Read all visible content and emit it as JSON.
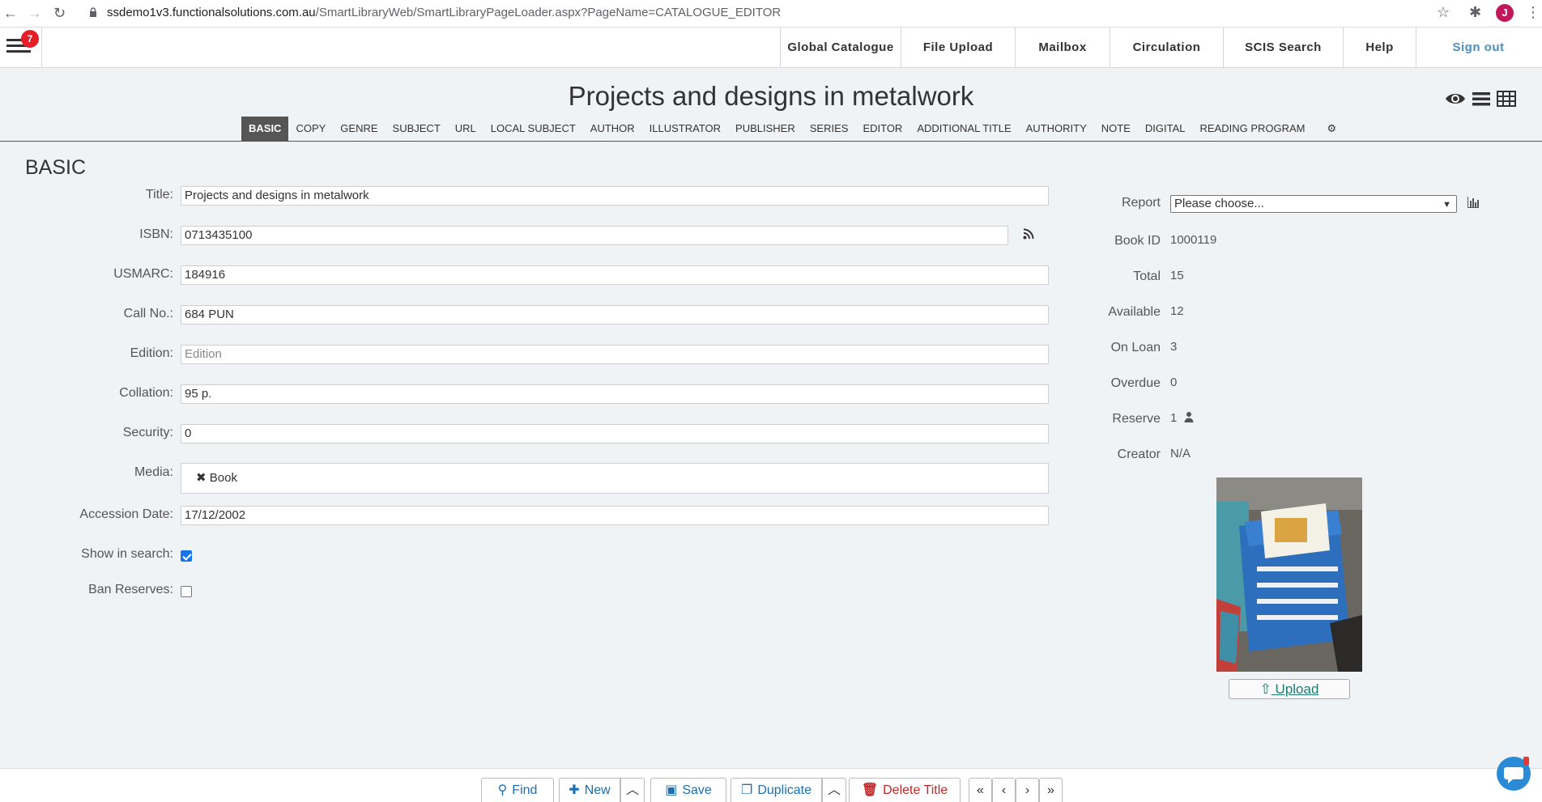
{
  "browser": {
    "url_host": "ssdemo1v3.functionalsolutions.com.au",
    "url_path": "/SmartLibraryWeb/SmartLibraryPageLoader.aspx?PageName=CATALOGUE_EDITOR",
    "profile_initial": "J"
  },
  "header": {
    "notification_count": "7",
    "menu": [
      {
        "label": "Global Catalogue"
      },
      {
        "label": "File Upload"
      },
      {
        "label": "Mailbox"
      },
      {
        "label": "Circulation"
      },
      {
        "label": "SCIS Search"
      },
      {
        "label": "Help"
      },
      {
        "label": "Sign out"
      }
    ]
  },
  "page_title": "Projects and designs in metalwork",
  "tabs": [
    {
      "label": "BASIC"
    },
    {
      "label": "COPY"
    },
    {
      "label": "GENRE"
    },
    {
      "label": "SUBJECT"
    },
    {
      "label": "URL"
    },
    {
      "label": "LOCAL SUBJECT"
    },
    {
      "label": "AUTHOR"
    },
    {
      "label": "ILLUSTRATOR"
    },
    {
      "label": "PUBLISHER"
    },
    {
      "label": "SERIES"
    },
    {
      "label": "EDITOR"
    },
    {
      "label": "ADDITIONAL TITLE"
    },
    {
      "label": "AUTHORITY"
    },
    {
      "label": "NOTE"
    },
    {
      "label": "DIGITAL"
    },
    {
      "label": "READING PROGRAM"
    },
    {
      "label": "⚙"
    }
  ],
  "section_title": "BASIC",
  "form": {
    "title": {
      "label": "Title:",
      "value": "Projects and designs in metalwork"
    },
    "isbn": {
      "label": "ISBN:",
      "value": "0713435100"
    },
    "usmarc": {
      "label": "USMARC:",
      "value": "184916"
    },
    "callno": {
      "label": "Call No.:",
      "value": "684 PUN"
    },
    "edition": {
      "label": "Edition:",
      "value": "",
      "placeholder": "Edition"
    },
    "collation": {
      "label": "Collation:",
      "value": "95 p."
    },
    "security": {
      "label": "Security:",
      "value": "0"
    },
    "media": {
      "label": "Media:",
      "tag": "Book"
    },
    "accession_date": {
      "label": "Accession Date:",
      "value": "17/12/2002"
    },
    "show_in_search": {
      "label": "Show in search:",
      "checked": true
    },
    "ban_reserves": {
      "label": "Ban Reserves:",
      "checked": false
    }
  },
  "info": {
    "report_label": "Report",
    "report_value": "Please choose...",
    "book_id": {
      "label": "Book ID",
      "value": "1000119"
    },
    "total": {
      "label": "Total",
      "value": "15"
    },
    "available": {
      "label": "Available",
      "value": "12"
    },
    "on_loan": {
      "label": "On Loan",
      "value": "3"
    },
    "overdue": {
      "label": "Overdue",
      "value": "0"
    },
    "reserve": {
      "label": "Reserve",
      "value": "1"
    },
    "creator": {
      "label": "Creator",
      "value": "N/A"
    },
    "upload_label": "Upload"
  },
  "toolbar": {
    "find": "Find",
    "new": "New",
    "save": "Save",
    "duplicate": "Duplicate",
    "delete": "Delete Title"
  },
  "colors": {
    "accent": "#1b6fb5",
    "danger": "#c62828",
    "badge": "#e41e26",
    "active_tab": "#555555"
  }
}
